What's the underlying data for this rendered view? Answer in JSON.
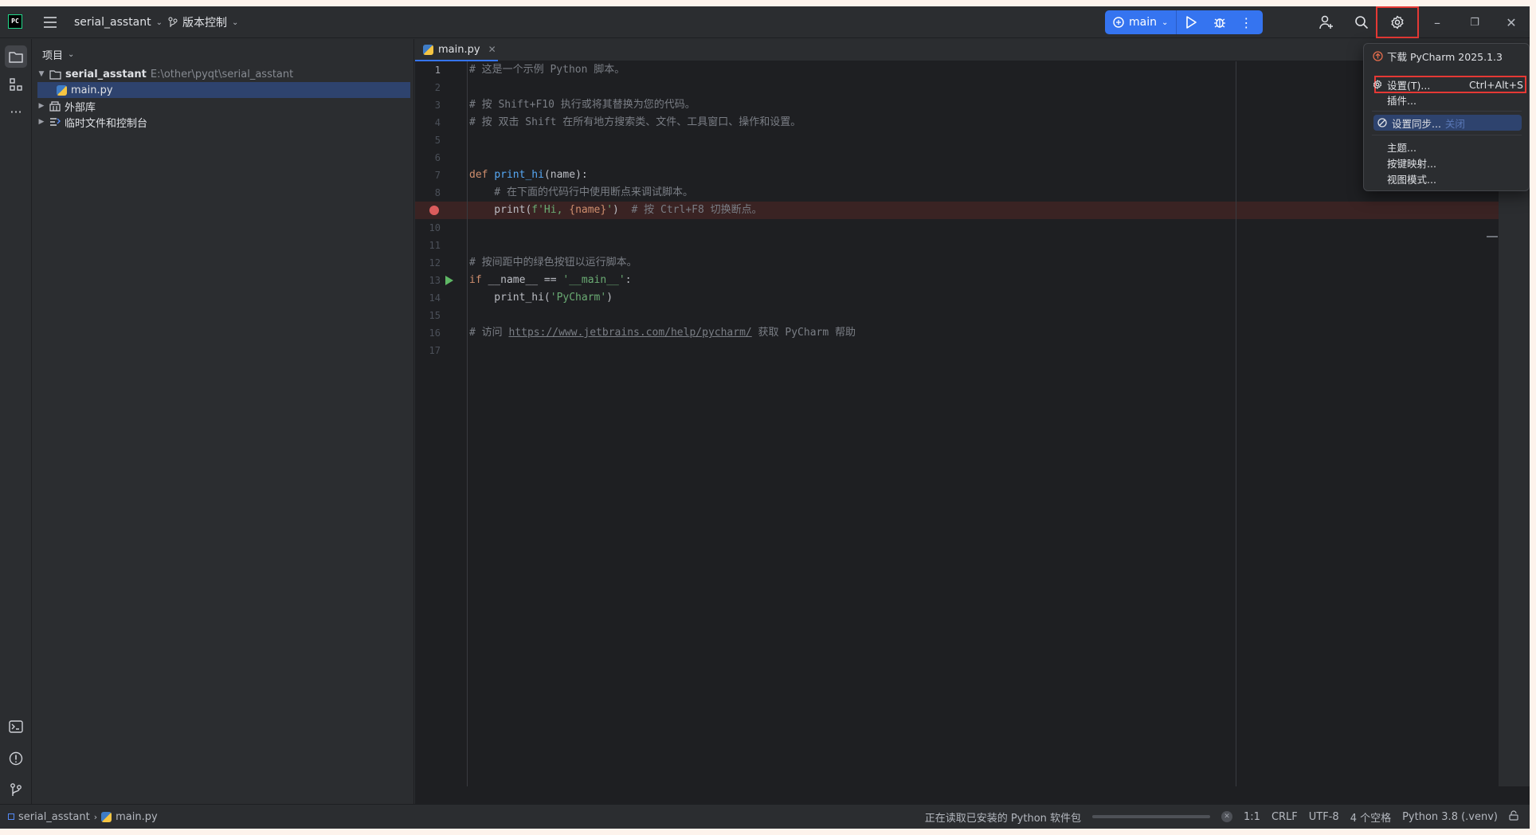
{
  "titlebar": {
    "project": "serial_asstant",
    "vcs": "版本控制",
    "branch": "main"
  },
  "project_panel": {
    "title": "项目",
    "tree": [
      {
        "label": "serial_asstant",
        "path": "E:\\other\\pyqt\\serial_asstant"
      },
      {
        "label": "main.py"
      },
      {
        "label": "外部库"
      },
      {
        "label": "临时文件和控制台"
      }
    ]
  },
  "editor": {
    "tab": "main.py",
    "line_numbers": [
      "1",
      "2",
      "3",
      "4",
      "5",
      "6",
      "7",
      "8",
      "9",
      "10",
      "11",
      "12",
      "13",
      "14",
      "15",
      "16",
      "17"
    ],
    "code": {
      "l1": "# 这是一个示例 Python 脚本。",
      "l3": "# 按 Shift+F10 执行或将其替换为您的代码。",
      "l4": "# 按 双击 Shift 在所有地方搜索类、文件、工具窗口、操作和设置。",
      "l7_kw": "def ",
      "l7_fn": "print_hi",
      "l7_rest": "(name):",
      "l8": "    # 在下面的代码行中使用断点来调试脚本。",
      "l9_a": "    print(",
      "l9_str1": "f'Hi, ",
      "l9_b": "{name}",
      "l9_str2": "'",
      "l9_c": ")  ",
      "l9_cmt": "# 按 Ctrl+F8 切换断点。",
      "l12": "# 按间距中的绿色按钮以运行脚本。",
      "l13_kw": "if ",
      "l13_a": "__name__ == ",
      "l13_str": "'__main__'",
      "l13_b": ":",
      "l14_a": "    print_hi(",
      "l14_str": "'PyCharm'",
      "l14_b": ")",
      "l16_a": "# 访问 ",
      "l16_link": "https://www.jetbrains.com/help/pycharm/",
      "l16_b": " 获取 PyCharm 帮助"
    }
  },
  "menu": {
    "download": "下载 PyCharm 2025.1.3",
    "settings": "设置(T)...",
    "settings_shortcut": "Ctrl+Alt+S",
    "plugins": "插件...",
    "sync": "设置同步...",
    "sync_state": "关闭",
    "theme": "主题...",
    "keymap": "按键映射...",
    "view_mode": "视图模式..."
  },
  "statusbar": {
    "crumb_project": "serial_asstant",
    "crumb_file": "main.py",
    "task": "正在读取已安装的 Python 软件包",
    "task_progress": 0.0,
    "position": "1:1",
    "line_sep": "CRLF",
    "encoding": "UTF-8",
    "indent": "4 个空格",
    "interpreter": "Python 3.8 (.venv)"
  },
  "colors": {
    "accent": "#3574f0",
    "highlight_border": "#e53935",
    "breakpoint": "#db5c5c",
    "run_gutter": "#5fb865"
  }
}
